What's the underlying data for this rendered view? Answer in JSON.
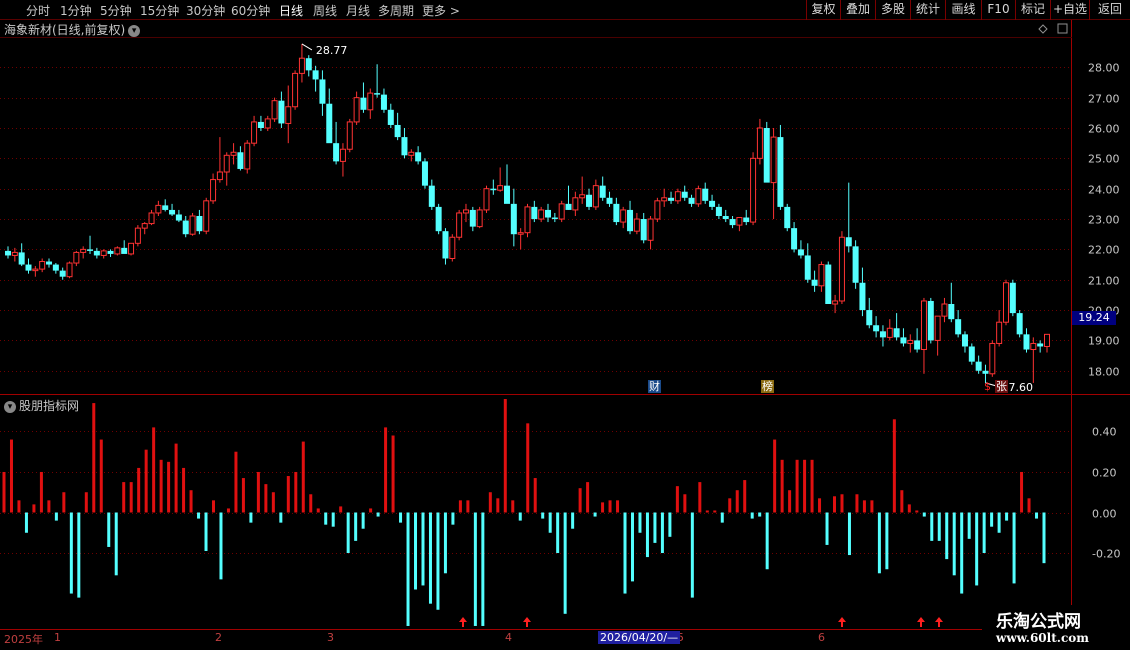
{
  "toolbar": {
    "periods": [
      "分时",
      "1分钟",
      "5分钟",
      "15分钟",
      "30分钟",
      "60分钟",
      "日线",
      "周线",
      "月线",
      "多周期",
      "更多 >"
    ],
    "active_period": "日线",
    "buttons": [
      "复权",
      "叠加",
      "多股",
      "统计",
      "画线",
      "F10",
      "标记",
      "+自选",
      "返回"
    ]
  },
  "stock_title": "海象新材(日线,前复权)",
  "sub_indicator_title": "股朋指标网",
  "current_price_label": "19.24",
  "high_label": "28.77",
  "low_label": "17.60",
  "event_badges": {
    "finance": "财",
    "ranking": "榜",
    "s_mark": "$",
    "rise": "张"
  },
  "date_axis": {
    "labels": [
      "2025年",
      "1",
      "2",
      "3",
      "4",
      "5",
      "6"
    ],
    "cursor": "2026/04/20/—"
  },
  "watermark": {
    "name": "乐淘公式网",
    "url": "www.60lt.com"
  },
  "colors": {
    "up": "#ff3333",
    "down": "#54ffff",
    "grid": "#6e0000",
    "axis_text": "#c8c8c8"
  },
  "chart_data": [
    {
      "type": "candlestick",
      "series_name": "海象新材(日线,前复权)",
      "y_ticks": [
        "28.00",
        "27.00",
        "26.00",
        "25.00",
        "24.00",
        "23.00",
        "22.00",
        "21.00",
        "20.00",
        "19.00",
        "18.00"
      ],
      "ylim": [
        17.3,
        28.9
      ],
      "grid": true,
      "ohlc": [
        [
          21.95,
          22.1,
          21.7,
          21.8
        ],
        [
          21.8,
          22.05,
          21.6,
          21.9
        ],
        [
          21.9,
          22.2,
          21.45,
          21.5
        ],
        [
          21.5,
          21.7,
          21.2,
          21.3
        ],
        [
          21.3,
          21.45,
          21.1,
          21.35
        ],
        [
          21.35,
          21.7,
          21.25,
          21.6
        ],
        [
          21.6,
          21.7,
          21.4,
          21.5
        ],
        [
          21.5,
          21.55,
          21.2,
          21.3
        ],
        [
          21.3,
          21.4,
          21.0,
          21.1
        ],
        [
          21.1,
          21.6,
          21.05,
          21.55
        ],
        [
          21.55,
          21.95,
          21.45,
          21.9
        ],
        [
          21.9,
          22.1,
          21.7,
          22.0
        ],
        [
          22.0,
          22.45,
          21.85,
          21.95
        ],
        [
          21.95,
          22.05,
          21.7,
          21.8
        ],
        [
          21.8,
          22.0,
          21.7,
          21.95
        ],
        [
          21.95,
          22.0,
          21.75,
          21.85
        ],
        [
          21.85,
          22.1,
          21.8,
          22.05
        ],
        [
          22.05,
          22.3,
          21.9,
          21.85
        ],
        [
          21.85,
          22.2,
          21.8,
          22.2
        ],
        [
          22.2,
          22.8,
          22.1,
          22.7
        ],
        [
          22.7,
          22.9,
          22.5,
          22.85
        ],
        [
          22.85,
          23.3,
          22.8,
          23.2
        ],
        [
          23.2,
          23.6,
          23.1,
          23.45
        ],
        [
          23.45,
          23.65,
          23.25,
          23.3
        ],
        [
          23.3,
          23.5,
          23.1,
          23.15
        ],
        [
          23.15,
          23.3,
          22.9,
          22.95
        ],
        [
          22.95,
          23.1,
          22.4,
          22.5
        ],
        [
          22.5,
          23.2,
          22.45,
          23.1
        ],
        [
          23.1,
          23.3,
          22.5,
          22.6
        ],
        [
          22.6,
          23.7,
          22.5,
          23.6
        ],
        [
          23.6,
          24.5,
          23.5,
          24.3
        ],
        [
          24.3,
          25.7,
          24.2,
          24.55
        ],
        [
          24.55,
          25.2,
          24.1,
          25.1
        ],
        [
          25.1,
          25.5,
          24.8,
          25.2
        ],
        [
          25.2,
          25.4,
          24.6,
          24.65
        ],
        [
          24.65,
          25.6,
          24.5,
          25.5
        ],
        [
          25.5,
          26.4,
          25.4,
          26.2
        ],
        [
          26.2,
          26.4,
          25.9,
          26.0
        ],
        [
          26.0,
          26.4,
          25.9,
          26.3
        ],
        [
          26.3,
          27.0,
          26.2,
          26.9
        ],
        [
          26.9,
          27.2,
          26.0,
          26.15
        ],
        [
          26.15,
          27.4,
          25.5,
          26.7
        ],
        [
          26.7,
          27.9,
          26.6,
          27.8
        ],
        [
          27.8,
          28.77,
          27.5,
          28.3
        ],
        [
          28.3,
          28.4,
          27.7,
          27.9
        ],
        [
          27.9,
          28.05,
          27.2,
          27.6
        ],
        [
          27.6,
          27.9,
          26.4,
          26.8
        ],
        [
          26.8,
          27.3,
          26.0,
          25.5
        ],
        [
          25.5,
          26.2,
          24.8,
          24.9
        ],
        [
          24.9,
          25.5,
          24.4,
          25.3
        ],
        [
          25.3,
          26.3,
          25.2,
          26.2
        ],
        [
          26.2,
          27.2,
          26.1,
          27.0
        ],
        [
          27.0,
          27.5,
          26.5,
          26.6
        ],
        [
          26.6,
          27.3,
          26.3,
          27.15
        ],
        [
          27.15,
          28.1,
          27.0,
          27.1
        ],
        [
          27.1,
          27.3,
          26.5,
          26.6
        ],
        [
          26.6,
          26.8,
          26.0,
          26.1
        ],
        [
          26.1,
          26.5,
          25.6,
          25.7
        ],
        [
          25.7,
          26.0,
          25.0,
          25.1
        ],
        [
          25.1,
          25.3,
          24.9,
          25.2
        ],
        [
          25.2,
          25.4,
          24.8,
          24.9
        ],
        [
          24.9,
          25.0,
          24.0,
          24.1
        ],
        [
          24.1,
          24.3,
          23.3,
          23.4
        ],
        [
          23.4,
          23.5,
          22.5,
          22.6
        ],
        [
          22.6,
          22.7,
          21.5,
          21.7
        ],
        [
          21.7,
          22.5,
          21.6,
          22.4
        ],
        [
          22.4,
          23.3,
          22.3,
          23.2
        ],
        [
          23.2,
          23.5,
          22.9,
          23.3
        ],
        [
          23.3,
          23.4,
          22.6,
          22.75
        ],
        [
          22.75,
          23.4,
          22.7,
          23.3
        ],
        [
          23.3,
          24.1,
          23.2,
          24.0
        ],
        [
          24.0,
          24.3,
          23.8,
          23.95
        ],
        [
          23.95,
          24.7,
          23.9,
          24.1
        ],
        [
          24.1,
          24.8,
          23.9,
          23.5
        ],
        [
          23.5,
          24.0,
          22.1,
          22.5
        ],
        [
          22.5,
          22.7,
          22.0,
          22.55
        ],
        [
          22.55,
          23.5,
          22.4,
          23.4
        ],
        [
          23.4,
          23.6,
          22.9,
          23.0
        ],
        [
          23.0,
          23.4,
          22.9,
          23.3
        ],
        [
          23.3,
          23.5,
          22.9,
          23.05
        ],
        [
          23.05,
          23.2,
          22.9,
          23.0
        ],
        [
          23.0,
          23.6,
          22.9,
          23.5
        ],
        [
          23.5,
          24.1,
          23.3,
          23.3
        ],
        [
          23.3,
          23.9,
          23.1,
          23.7
        ],
        [
          23.7,
          24.4,
          23.5,
          23.8
        ],
        [
          23.8,
          24.0,
          23.3,
          23.4
        ],
        [
          23.4,
          24.3,
          23.3,
          24.1
        ],
        [
          24.1,
          24.4,
          23.6,
          23.7
        ],
        [
          23.7,
          23.9,
          23.4,
          23.5
        ],
        [
          23.5,
          23.7,
          22.8,
          22.9
        ],
        [
          22.9,
          23.4,
          22.7,
          23.3
        ],
        [
          23.3,
          23.6,
          22.5,
          22.6
        ],
        [
          22.6,
          23.2,
          22.5,
          23.0
        ],
        [
          23.0,
          23.2,
          22.2,
          22.3
        ],
        [
          22.3,
          23.1,
          22.0,
          23.0
        ],
        [
          23.0,
          23.7,
          22.9,
          23.6
        ],
        [
          23.6,
          24.0,
          23.4,
          23.7
        ],
        [
          23.7,
          23.9,
          23.5,
          23.6
        ],
        [
          23.6,
          24.0,
          23.5,
          23.9
        ],
        [
          23.9,
          24.1,
          23.6,
          23.7
        ],
        [
          23.7,
          23.8,
          23.4,
          23.5
        ],
        [
          23.5,
          24.1,
          23.4,
          24.0
        ],
        [
          24.0,
          24.2,
          23.5,
          23.6
        ],
        [
          23.6,
          23.8,
          23.3,
          23.4
        ],
        [
          23.4,
          23.5,
          23.0,
          23.1
        ],
        [
          23.1,
          23.3,
          22.9,
          23.0
        ],
        [
          23.0,
          23.1,
          22.7,
          22.8
        ],
        [
          22.8,
          23.0,
          22.6,
          23.05
        ],
        [
          23.05,
          23.3,
          22.8,
          22.9
        ],
        [
          22.9,
          25.2,
          22.8,
          25.0
        ],
        [
          25.0,
          26.3,
          24.8,
          26.0
        ],
        [
          26.0,
          26.2,
          24.8,
          24.2
        ],
        [
          24.2,
          26.0,
          23.0,
          25.7
        ],
        [
          25.7,
          26.1,
          23.3,
          23.4
        ],
        [
          23.4,
          23.5,
          22.6,
          22.7
        ],
        [
          22.7,
          22.9,
          21.9,
          22.0
        ],
        [
          22.0,
          22.3,
          21.7,
          21.8
        ],
        [
          21.8,
          22.2,
          20.9,
          21.0
        ],
        [
          21.0,
          21.3,
          20.6,
          20.8
        ],
        [
          20.8,
          21.6,
          20.6,
          21.5
        ],
        [
          21.5,
          21.6,
          20.4,
          20.2
        ],
        [
          20.2,
          20.5,
          19.9,
          20.3
        ],
        [
          20.3,
          22.6,
          20.2,
          22.4
        ],
        [
          22.4,
          24.2,
          21.9,
          22.1
        ],
        [
          22.1,
          22.3,
          20.7,
          20.9
        ],
        [
          20.9,
          21.4,
          19.8,
          20.0
        ],
        [
          20.0,
          20.4,
          19.4,
          19.5
        ],
        [
          19.5,
          19.8,
          19.1,
          19.3
        ],
        [
          19.3,
          19.5,
          18.8,
          19.1
        ],
        [
          19.1,
          19.7,
          19.0,
          19.4
        ],
        [
          19.4,
          19.9,
          19.0,
          19.1
        ],
        [
          19.1,
          19.4,
          18.8,
          18.9
        ],
        [
          18.9,
          19.2,
          18.6,
          19.0
        ],
        [
          19.0,
          19.4,
          18.6,
          18.7
        ],
        [
          18.7,
          20.4,
          17.9,
          20.3
        ],
        [
          20.3,
          20.4,
          18.9,
          19.0
        ],
        [
          19.0,
          19.8,
          18.5,
          19.8
        ],
        [
          19.8,
          20.4,
          19.6,
          20.2
        ],
        [
          20.2,
          20.9,
          19.6,
          19.7
        ],
        [
          19.7,
          20.0,
          19.1,
          19.2
        ],
        [
          19.2,
          19.3,
          18.6,
          18.8
        ],
        [
          18.8,
          18.9,
          18.2,
          18.3
        ],
        [
          18.3,
          18.5,
          17.9,
          18.0
        ],
        [
          18.0,
          18.2,
          17.6,
          17.9
        ],
        [
          17.9,
          19.0,
          17.8,
          18.9
        ],
        [
          18.9,
          20.0,
          18.8,
          19.6
        ],
        [
          19.6,
          21.0,
          19.5,
          20.9
        ],
        [
          20.9,
          21.0,
          19.8,
          19.9
        ],
        [
          19.9,
          20.0,
          19.1,
          19.2
        ],
        [
          19.2,
          19.4,
          18.6,
          18.7
        ],
        [
          18.7,
          19.1,
          17.6,
          18.9
        ],
        [
          18.9,
          19.0,
          18.6,
          18.8
        ],
        [
          18.8,
          19.1,
          18.6,
          19.2
        ]
      ]
    },
    {
      "type": "bar",
      "series_name": "股朋指标网",
      "y_ticks": [
        "0.40",
        "0.20",
        "0.00",
        "-0.20"
      ],
      "ylim": [
        -0.57,
        0.57
      ],
      "grid": true,
      "values": [
        0.2,
        0.36,
        0.06,
        -0.1,
        0.04,
        0.2,
        0.06,
        -0.04,
        0.1,
        -0.4,
        -0.42,
        0.1,
        0.54,
        0.36,
        -0.17,
        -0.31,
        0.15,
        0.15,
        0.22,
        0.31,
        0.42,
        0.26,
        0.25,
        0.34,
        0.22,
        0.11,
        -0.03,
        -0.19,
        0.06,
        -0.33,
        0.02,
        0.3,
        0.17,
        -0.05,
        0.2,
        0.14,
        0.1,
        -0.05,
        0.18,
        0.2,
        0.35,
        0.09,
        0.02,
        -0.06,
        -0.07,
        0.03,
        -0.2,
        -0.14,
        -0.08,
        0.02,
        -0.02,
        0.42,
        0.38,
        -0.05,
        -0.56,
        -0.38,
        -0.36,
        -0.45,
        -0.48,
        -0.3,
        -0.06,
        0.06,
        0.06,
        -0.56,
        -0.56,
        0.1,
        0.07,
        0.56,
        0.06,
        -0.04,
        0.44,
        0.17,
        -0.03,
        -0.1,
        -0.2,
        -0.5,
        -0.08,
        0.12,
        0.15,
        -0.02,
        0.05,
        0.06,
        0.06,
        -0.4,
        -0.34,
        -0.1,
        -0.22,
        -0.15,
        -0.2,
        -0.12,
        0.13,
        0.09,
        -0.42,
        0.15,
        0.01,
        0.01,
        -0.05,
        0.07,
        0.11,
        0.16,
        -0.03,
        -0.02,
        -0.28,
        0.36,
        0.26,
        0.11,
        0.26,
        0.26,
        0.26,
        0.07,
        -0.16,
        0.08,
        0.09,
        -0.21,
        0.09,
        0.06,
        0.06,
        -0.3,
        -0.28,
        0.46,
        0.11,
        0.04,
        0.01,
        -0.02,
        -0.14,
        -0.14,
        -0.23,
        -0.31,
        -0.4,
        -0.13,
        -0.36,
        -0.2,
        -0.07,
        -0.1,
        -0.04,
        -0.35,
        0.2,
        0.07,
        -0.03,
        -0.25
      ]
    }
  ]
}
